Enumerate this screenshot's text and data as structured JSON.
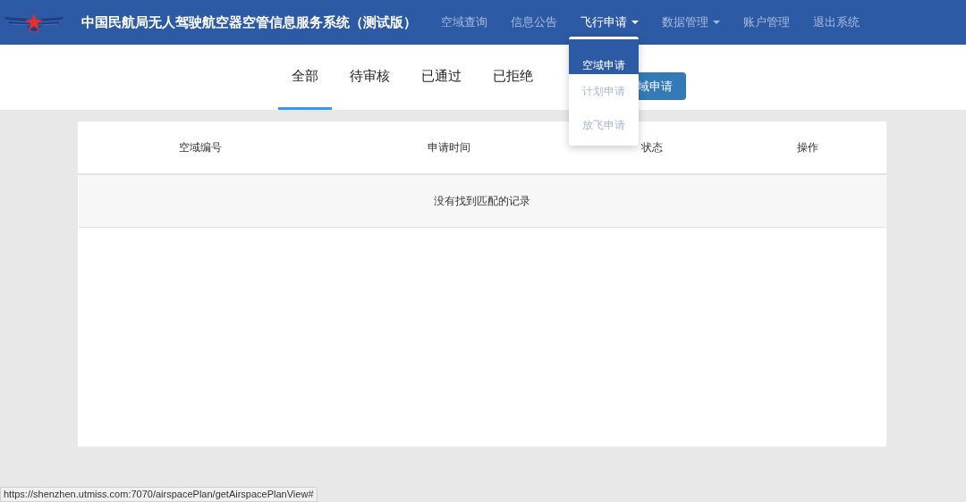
{
  "header": {
    "title": "中国民航局无人驾驶航空器空管信息服务系统（测试版）"
  },
  "nav": [
    {
      "label": "空域查询",
      "selected": false,
      "has_menu": false
    },
    {
      "label": "信息公告",
      "selected": false,
      "has_menu": false
    },
    {
      "label": "飞行申请",
      "selected": true,
      "has_menu": true
    },
    {
      "label": "数据管理",
      "selected": false,
      "has_menu": true
    },
    {
      "label": "账户管理",
      "selected": false,
      "has_menu": false
    },
    {
      "label": "退出系统",
      "selected": false,
      "has_menu": false
    }
  ],
  "dropdown": {
    "items": [
      {
        "label": "空域申请",
        "selected": true
      },
      {
        "label": "计划申请",
        "selected": false
      },
      {
        "label": "放飞申请",
        "selected": false
      }
    ]
  },
  "tabs": [
    {
      "label": "全部",
      "selected": true
    },
    {
      "label": "待审核",
      "selected": false
    },
    {
      "label": "已通过",
      "selected": false
    },
    {
      "label": "已拒绝",
      "selected": false
    }
  ],
  "action_button": "域申请",
  "table": {
    "columns": [
      "空域编号",
      "申请时间",
      "状态",
      "操作"
    ],
    "empty_message": "没有找到匹配的记录"
  },
  "status_bar": "https://shenzhen.utmiss.com:7070/airspacePlan/getAirspacePlanView#"
}
